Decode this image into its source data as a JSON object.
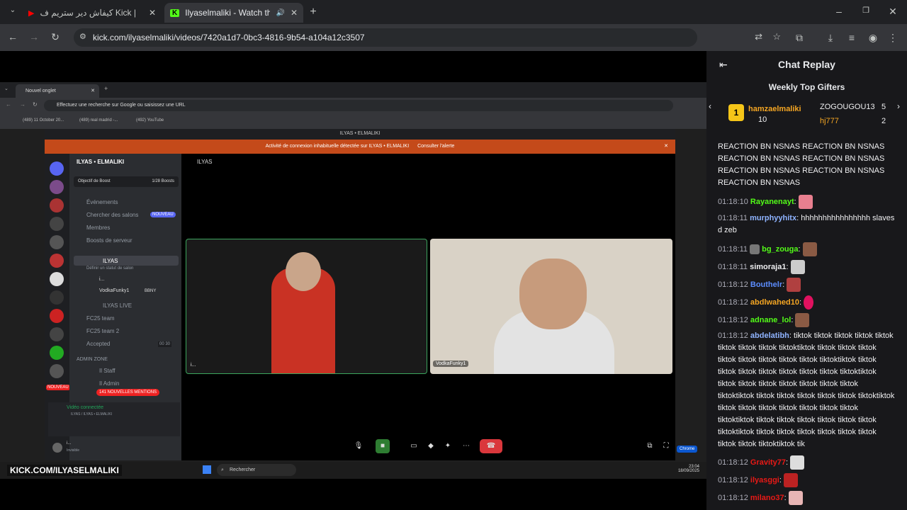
{
  "browser": {
    "tabs": [
      {
        "title": "كيفاش دير ستريم ف Kick | كل ما",
        "icon": "youtube-icon",
        "color": "#ff0000"
      },
      {
        "title": "Ilyaselmaliki - Watch the VC",
        "icon": "kick-icon",
        "color": "#53fc18"
      }
    ],
    "url": "kick.com/ilyaselmaliki/videos/7420a1d7-0bc3-4816-9b54-a104a12c3507"
  },
  "inner_browser": {
    "tab": "Nouvel onglet",
    "address": "Effectuez une recherche sur Google ou saisissez une URL",
    "bookmarks": [
      "(489) 11 October 20...",
      "(489) real madrid -...",
      "(492) YouTube"
    ]
  },
  "discord": {
    "window_title": "ILYAS • ELMALIKI",
    "alert": "Activité de connexion inhabituelle détectée sur ILYAS • ELMALIKI",
    "alert_action": "Consulter l'alerte",
    "server_name": "ILYAS • ELMALIKI",
    "boost_label": "Objectif de Boost",
    "boost_count": "1/28 Boosts",
    "menu": [
      "Événements",
      "Chercher des salons",
      "Membres",
      "Boosts de serveur"
    ],
    "new_badge": "NOUVEAU",
    "voice_channel": "ILYAS",
    "voice_status": "Définir un statut de salon",
    "voice_users": [
      "i...",
      "VodkaFunky1"
    ],
    "voice_user_tag": "BBNY",
    "channels": [
      "ILYAS LIVE",
      "FC25 team",
      "FC25 team 2",
      "Accepted"
    ],
    "accepted_count": "00 30",
    "category": "ADMIN ZONE",
    "admin_channels": [
      "Il Staff",
      "Il Admin"
    ],
    "mentions": "141 NOUVELLES MENTIONS",
    "new_server_badge": "NOUVEAU",
    "video_connected": "Vidéo connectée",
    "video_location": "ILYAS / ILYAS • ELMALIKI",
    "user_name": "i...",
    "user_status": "Invisible",
    "stage_header": "ILYAS",
    "cam1_label": "i...",
    "cam2_label": "VodkaFunky1"
  },
  "taskbar": {
    "search": "Rechercher",
    "time": "23:04",
    "date": "18/09/2025",
    "chrome_hint": "Chrome"
  },
  "kick_banner": "KICK.COM/ILYASELMALIKI",
  "chat": {
    "title": "Chat Replay",
    "gifters_title": "Weekly Top Gifters",
    "gifters": [
      {
        "name": "hamzaelmaliki",
        "count": "10",
        "rank": "1",
        "color": "#bf94ff"
      },
      {
        "name": "ZOGOUGOU13",
        "count": "5",
        "color": "#efeff1"
      },
      {
        "name": "hj777",
        "count": "2",
        "color": "#f5a623"
      }
    ],
    "spam_top": "REACTION BN NSNAS REACTION BN NSNAS REACTION BN NSNAS REACTION BN NSNAS REACTION BN NSNAS REACTION BN NSNAS REACTION BN NSNAS",
    "messages": [
      {
        "ts": "01:18:10",
        "user": "Rayanenayt",
        "color": "#53fc18",
        "text": ":"
      },
      {
        "ts": "01:18:11",
        "user": "murphyyhitx",
        "color": "#8fb3ff",
        "text": ": hhhhhhhhhhhhhhhh slaves d zeb"
      },
      {
        "ts": "01:18:11",
        "user": "bg_zouga",
        "color": "#53fc18",
        "text": ":"
      },
      {
        "ts": "01:18:11",
        "user": "simoraja1",
        "color": "#efeff1",
        "text": ":"
      },
      {
        "ts": "01:18:12",
        "user": "Bouthelr",
        "color": "#5c8dff",
        "text": ":"
      },
      {
        "ts": "01:18:12",
        "user": "abdlwahed10",
        "color": "#f5a623",
        "text": ":"
      },
      {
        "ts": "01:18:12",
        "user": "adnane_lol",
        "color": "#53fc18",
        "text": ":"
      },
      {
        "ts": "01:18:12",
        "user": "abdelatibh",
        "color": "#8fb3ff",
        "text": ": tiktok tiktok tiktok tiktok tiktok tiktok tiktok tiktok tiktoktiktok tiktok tiktok tiktok tiktok tiktok tiktok tiktok tiktok tiktoktiktok tiktok tiktok tiktok tiktok tiktok tiktok tiktok tiktoktiktok tiktok tiktok tiktok tiktok tiktok tiktok tiktok tiktoktiktok tiktok tiktok tiktok tiktok tiktok tiktoktiktok tiktok tiktok tiktok tiktok tiktok tiktok tiktok tiktoktiktok tiktok tiktok tiktok tiktok tiktok tiktok tiktoktiktok tiktok tiktok tiktok tiktok tiktok tiktok tiktok tiktok tiktoktiktok tik"
      },
      {
        "ts": "01:18:12",
        "user": "Gravity77",
        "color": "#e91916",
        "text": ":"
      },
      {
        "ts": "01:18:12",
        "user": "ilyasggi",
        "color": "#e91916",
        "text": ":"
      },
      {
        "ts": "01:18:12",
        "user": "milano37",
        "color": "#e91916",
        "text": ":"
      }
    ]
  }
}
